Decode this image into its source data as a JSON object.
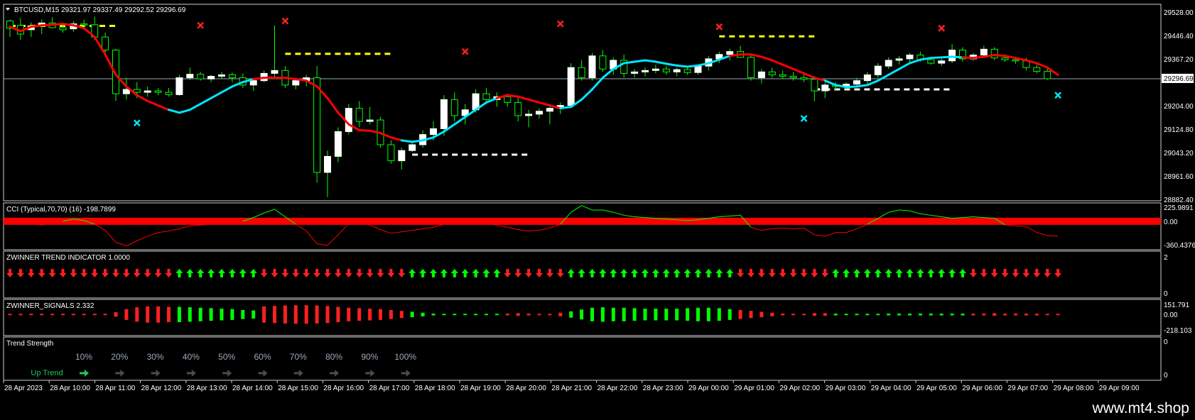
{
  "main": {
    "header": "BTCUSD,M15  29321.97 29337.49 29292.52 29296.69",
    "ylim": [
      28882.4,
      29528.0
    ],
    "y_ticks": [
      "29528.00",
      "29446.40",
      "29367.20",
      "29204.00",
      "29124.80",
      "29043.20",
      "28961.60",
      "28882.40"
    ],
    "current_price": "29296.69",
    "candle_colors": {
      "bull": "#ffffff",
      "bear": "#000000",
      "wick": "#00ff00",
      "outline": "#00ff00"
    },
    "trend_colors": {
      "down": "#ff0000",
      "up": "#00e5ff"
    }
  },
  "cci": {
    "label": "CCI (Typical,70,70) (16) -198.7899",
    "ticks": [
      "225.9891",
      "0.00",
      "-360.4376"
    ],
    "line_color": "#ff0000",
    "up_color": "#00ff00"
  },
  "trend_panel": {
    "label": "ZWINNER TREND INDICATOR 1.0000",
    "ticks": [
      "2",
      "0"
    ],
    "up_color": "#00ff00",
    "down_color": "#ff2020"
  },
  "signals": {
    "label": "ZWINNER_SIGNALS 2.332",
    "ticks": [
      "151.791",
      "0.00",
      "-218.103"
    ]
  },
  "strength": {
    "label": "Trend Strength",
    "ticks": [
      "0",
      "0"
    ],
    "percents": [
      "10%",
      "20%",
      "30%",
      "40%",
      "50%",
      "60%",
      "70%",
      "80%",
      "90%",
      "100%"
    ],
    "trend_label": "Up Trend"
  },
  "time_axis": [
    "28 Apr 2023",
    "28 Apr 10:00",
    "28 Apr 11:00",
    "28 Apr 12:00",
    "28 Apr 13:00",
    "28 Apr 14:00",
    "28 Apr 15:00",
    "28 Apr 16:00",
    "28 Apr 17:00",
    "28 Apr 18:00",
    "28 Apr 19:00",
    "28 Apr 20:00",
    "28 Apr 21:00",
    "28 Apr 22:00",
    "28 Apr 23:00",
    "29 Apr 00:00",
    "29 Apr 01:00",
    "29 Apr 02:00",
    "29 Apr 03:00",
    "29 Apr 04:00",
    "29 Apr 05:00",
    "29 Apr 06:00",
    "29 Apr 07:00",
    "29 Apr 08:00",
    "29 Apr 09:00"
  ],
  "footer": {
    "url": "www.mt4.shop"
  },
  "chart_data": {
    "type": "candlestick",
    "symbol": "BTCUSD",
    "timeframe": "M15",
    "ylim": [
      28882.4,
      29528.0
    ],
    "candles": [
      {
        "o": 29495,
        "h": 29500,
        "l": 29440,
        "c": 29470
      },
      {
        "o": 29480,
        "h": 29505,
        "l": 29430,
        "c": 29450
      },
      {
        "o": 29465,
        "h": 29490,
        "l": 29440,
        "c": 29478
      },
      {
        "o": 29478,
        "h": 29500,
        "l": 29450,
        "c": 29488
      },
      {
        "o": 29488,
        "h": 29508,
        "l": 29470,
        "c": 29472
      },
      {
        "o": 29472,
        "h": 29485,
        "l": 29455,
        "c": 29465
      },
      {
        "o": 29468,
        "h": 29495,
        "l": 29458,
        "c": 29485
      },
      {
        "o": 29485,
        "h": 29500,
        "l": 29470,
        "c": 29482
      },
      {
        "o": 29482,
        "h": 29510,
        "l": 29430,
        "c": 29440
      },
      {
        "o": 29440,
        "h": 29455,
        "l": 29380,
        "c": 29395
      },
      {
        "o": 29395,
        "h": 29400,
        "l": 29220,
        "c": 29245
      },
      {
        "o": 29245,
        "h": 29300,
        "l": 29225,
        "c": 29260
      },
      {
        "o": 29260,
        "h": 29285,
        "l": 29230,
        "c": 29250
      },
      {
        "o": 29250,
        "h": 29270,
        "l": 29235,
        "c": 29255
      },
      {
        "o": 29255,
        "h": 29265,
        "l": 29240,
        "c": 29250
      },
      {
        "o": 29250,
        "h": 29265,
        "l": 29235,
        "c": 29242
      },
      {
        "o": 29242,
        "h": 29310,
        "l": 29238,
        "c": 29300
      },
      {
        "o": 29300,
        "h": 29335,
        "l": 29292,
        "c": 29312
      },
      {
        "o": 29312,
        "h": 29320,
        "l": 29290,
        "c": 29296
      },
      {
        "o": 29296,
        "h": 29310,
        "l": 29285,
        "c": 29305
      },
      {
        "o": 29305,
        "h": 29320,
        "l": 29295,
        "c": 29310
      },
      {
        "o": 29310,
        "h": 29318,
        "l": 29285,
        "c": 29300
      },
      {
        "o": 29300,
        "h": 29315,
        "l": 29265,
        "c": 29275
      },
      {
        "o": 29275,
        "h": 29300,
        "l": 29255,
        "c": 29290
      },
      {
        "o": 29290,
        "h": 29325,
        "l": 29285,
        "c": 29315
      },
      {
        "o": 29315,
        "h": 29480,
        "l": 29300,
        "c": 29325
      },
      {
        "o": 29325,
        "h": 29340,
        "l": 29265,
        "c": 29275
      },
      {
        "o": 29275,
        "h": 29300,
        "l": 29260,
        "c": 29290
      },
      {
        "o": 29290,
        "h": 29310,
        "l": 29270,
        "c": 29300
      },
      {
        "o": 29300,
        "h": 29340,
        "l": 28940,
        "c": 28975
      },
      {
        "o": 28975,
        "h": 29050,
        "l": 28890,
        "c": 29030
      },
      {
        "o": 29030,
        "h": 29130,
        "l": 29010,
        "c": 29115
      },
      {
        "o": 29115,
        "h": 29210,
        "l": 29105,
        "c": 29195
      },
      {
        "o": 29195,
        "h": 29220,
        "l": 29130,
        "c": 29150
      },
      {
        "o": 29150,
        "h": 29200,
        "l": 29140,
        "c": 29155
      },
      {
        "o": 29155,
        "h": 29165,
        "l": 29060,
        "c": 29070
      },
      {
        "o": 29070,
        "h": 29085,
        "l": 29005,
        "c": 29015
      },
      {
        "o": 29015,
        "h": 29060,
        "l": 28985,
        "c": 29050
      },
      {
        "o": 29050,
        "h": 29080,
        "l": 29045,
        "c": 29070
      },
      {
        "o": 29070,
        "h": 29120,
        "l": 29060,
        "c": 29105
      },
      {
        "o": 29105,
        "h": 29150,
        "l": 29085,
        "c": 29125
      },
      {
        "o": 29125,
        "h": 29240,
        "l": 29100,
        "c": 29225
      },
      {
        "o": 29225,
        "h": 29250,
        "l": 29150,
        "c": 29170
      },
      {
        "o": 29170,
        "h": 29210,
        "l": 29140,
        "c": 29190
      },
      {
        "o": 29190,
        "h": 29260,
        "l": 29180,
        "c": 29245
      },
      {
        "o": 29245,
        "h": 29265,
        "l": 29210,
        "c": 29225
      },
      {
        "o": 29225,
        "h": 29250,
        "l": 29200,
        "c": 29235
      },
      {
        "o": 29235,
        "h": 29245,
        "l": 29200,
        "c": 29215
      },
      {
        "o": 29215,
        "h": 29240,
        "l": 29150,
        "c": 29170
      },
      {
        "o": 29170,
        "h": 29190,
        "l": 29130,
        "c": 29175
      },
      {
        "o": 29175,
        "h": 29195,
        "l": 29160,
        "c": 29185
      },
      {
        "o": 29185,
        "h": 29210,
        "l": 29140,
        "c": 29195
      },
      {
        "o": 29195,
        "h": 29215,
        "l": 29175,
        "c": 29205
      },
      {
        "o": 29205,
        "h": 29350,
        "l": 29200,
        "c": 29335
      },
      {
        "o": 29335,
        "h": 29360,
        "l": 29290,
        "c": 29300
      },
      {
        "o": 29300,
        "h": 29385,
        "l": 29290,
        "c": 29375
      },
      {
        "o": 29375,
        "h": 29395,
        "l": 29320,
        "c": 29330
      },
      {
        "o": 29330,
        "h": 29370,
        "l": 29310,
        "c": 29360
      },
      {
        "o": 29360,
        "h": 29380,
        "l": 29300,
        "c": 29315
      },
      {
        "o": 29315,
        "h": 29330,
        "l": 29300,
        "c": 29320
      },
      {
        "o": 29320,
        "h": 29335,
        "l": 29305,
        "c": 29325
      },
      {
        "o": 29325,
        "h": 29345,
        "l": 29315,
        "c": 29330
      },
      {
        "o": 29330,
        "h": 29340,
        "l": 29310,
        "c": 29320
      },
      {
        "o": 29320,
        "h": 29335,
        "l": 29305,
        "c": 29328
      },
      {
        "o": 29328,
        "h": 29340,
        "l": 29310,
        "c": 29318
      },
      {
        "o": 29318,
        "h": 29345,
        "l": 29310,
        "c": 29340
      },
      {
        "o": 29340,
        "h": 29375,
        "l": 29325,
        "c": 29365
      },
      {
        "o": 29365,
        "h": 29390,
        "l": 29350,
        "c": 29380
      },
      {
        "o": 29380,
        "h": 29400,
        "l": 29360,
        "c": 29390
      },
      {
        "o": 29390,
        "h": 29410,
        "l": 29370,
        "c": 29370
      },
      {
        "o": 29370,
        "h": 29380,
        "l": 29290,
        "c": 29300
      },
      {
        "o": 29300,
        "h": 29330,
        "l": 29280,
        "c": 29320
      },
      {
        "o": 29320,
        "h": 29335,
        "l": 29300,
        "c": 29310
      },
      {
        "o": 29310,
        "h": 29325,
        "l": 29295,
        "c": 29305
      },
      {
        "o": 29305,
        "h": 29320,
        "l": 29290,
        "c": 29300
      },
      {
        "o": 29300,
        "h": 29315,
        "l": 29285,
        "c": 29295
      },
      {
        "o": 29295,
        "h": 29305,
        "l": 29220,
        "c": 29255
      },
      {
        "o": 29255,
        "h": 29285,
        "l": 29230,
        "c": 29275
      },
      {
        "o": 29275,
        "h": 29285,
        "l": 29255,
        "c": 29270
      },
      {
        "o": 29270,
        "h": 29285,
        "l": 29260,
        "c": 29278
      },
      {
        "o": 29278,
        "h": 29300,
        "l": 29268,
        "c": 29290
      },
      {
        "o": 29290,
        "h": 29320,
        "l": 29280,
        "c": 29310
      },
      {
        "o": 29310,
        "h": 29350,
        "l": 29300,
        "c": 29340
      },
      {
        "o": 29340,
        "h": 29370,
        "l": 29330,
        "c": 29360
      },
      {
        "o": 29360,
        "h": 29375,
        "l": 29345,
        "c": 29365
      },
      {
        "o": 29365,
        "h": 29385,
        "l": 29350,
        "c": 29378
      },
      {
        "o": 29378,
        "h": 29390,
        "l": 29355,
        "c": 29362
      },
      {
        "o": 29362,
        "h": 29370,
        "l": 29345,
        "c": 29350
      },
      {
        "o": 29350,
        "h": 29365,
        "l": 29340,
        "c": 29358
      },
      {
        "o": 29358,
        "h": 29415,
        "l": 29350,
        "c": 29395
      },
      {
        "o": 29395,
        "h": 29405,
        "l": 29355,
        "c": 29365
      },
      {
        "o": 29365,
        "h": 29385,
        "l": 29358,
        "c": 29378
      },
      {
        "o": 29378,
        "h": 29410,
        "l": 29370,
        "c": 29398
      },
      {
        "o": 29398,
        "h": 29405,
        "l": 29360,
        "c": 29368
      },
      {
        "o": 29368,
        "h": 29380,
        "l": 29355,
        "c": 29362
      },
      {
        "o": 29362,
        "h": 29372,
        "l": 29348,
        "c": 29358
      },
      {
        "o": 29358,
        "h": 29368,
        "l": 29325,
        "c": 29335
      },
      {
        "o": 29335,
        "h": 29345,
        "l": 29315,
        "c": 29322
      },
      {
        "o": 29321.97,
        "h": 29337.49,
        "l": 29292.52,
        "c": 29296.69
      }
    ],
    "trend_line": [
      29475,
      29460,
      29475,
      29480,
      29482,
      29485,
      29480,
      29470,
      29440,
      29380,
      29310,
      29270,
      29240,
      29220,
      29205,
      29190,
      29180,
      29190,
      29210,
      29230,
      29250,
      29270,
      29285,
      29295,
      29300,
      29300,
      29300,
      29295,
      29290,
      29270,
      29230,
      29180,
      29140,
      29120,
      29118,
      29110,
      29095,
      29085,
      29080,
      29085,
      29095,
      29115,
      29140,
      29165,
      29190,
      29215,
      29230,
      29240,
      29235,
      29225,
      29215,
      29205,
      29195,
      29200,
      29225,
      29260,
      29300,
      29330,
      29350,
      29355,
      29360,
      29355,
      29348,
      29342,
      29338,
      29342,
      29350,
      29362,
      29375,
      29380,
      29380,
      29372,
      29360,
      29345,
      29330,
      29315,
      29300,
      29290,
      29275,
      29268,
      29270,
      29275,
      29290,
      29310,
      29330,
      29350,
      29362,
      29368,
      29370,
      29372,
      29370,
      29368,
      29372,
      29378,
      29375,
      29368,
      29360,
      29350,
      29335,
      29310
    ],
    "trend_up": [
      0,
      0,
      0,
      0,
      0,
      0,
      0,
      0,
      0,
      0,
      0,
      0,
      0,
      0,
      0,
      0,
      1,
      1,
      1,
      1,
      1,
      1,
      1,
      1,
      0,
      0,
      0,
      0,
      0,
      0,
      0,
      0,
      0,
      0,
      0,
      0,
      0,
      0,
      1,
      1,
      1,
      1,
      1,
      1,
      1,
      1,
      1,
      0,
      0,
      0,
      0,
      0,
      0,
      1,
      1,
      1,
      1,
      1,
      1,
      1,
      1,
      1,
      1,
      1,
      1,
      1,
      1,
      1,
      1,
      0,
      0,
      0,
      0,
      0,
      0,
      0,
      0,
      0,
      1,
      1,
      1,
      1,
      1,
      1,
      1,
      1,
      1,
      1,
      1,
      1,
      1,
      0,
      0,
      0,
      0,
      0,
      0,
      0,
      0,
      0
    ],
    "sell_marks": [
      {
        "i": 18,
        "p": 29480
      },
      {
        "i": 26,
        "p": 29495
      },
      {
        "i": 43,
        "p": 29390
      },
      {
        "i": 52,
        "p": 29485
      },
      {
        "i": 67,
        "p": 29475
      },
      {
        "i": 88,
        "p": 29470
      }
    ],
    "buy_marks": [
      {
        "i": 12,
        "p": 29145
      },
      {
        "i": 75,
        "p": 29160
      },
      {
        "i": 99,
        "p": 29240
      }
    ],
    "levels": [
      {
        "price": 29478,
        "from": 0,
        "to": 10,
        "color": "#ffff00"
      },
      {
        "price": 29382,
        "from": 26,
        "to": 36,
        "color": "#ffff00"
      },
      {
        "price": 29036,
        "from": 38,
        "to": 49,
        "color": "#ffffff"
      },
      {
        "price": 29442,
        "from": 67,
        "to": 76,
        "color": "#ffff00"
      },
      {
        "price": 29260,
        "from": 76,
        "to": 89,
        "color": "#ffffff"
      }
    ],
    "cci_values": [
      0,
      -10,
      -30,
      -50,
      -20,
      0,
      30,
      10,
      -40,
      -120,
      -280,
      -330,
      -260,
      -200,
      -150,
      -130,
      -100,
      -60,
      -50,
      -40,
      -30,
      -20,
      0,
      50,
      110,
      160,
      60,
      -40,
      -130,
      -300,
      -320,
      -180,
      -30,
      -10,
      -50,
      -110,
      -160,
      -140,
      -120,
      -100,
      -80,
      -40,
      -20,
      -30,
      -40,
      -30,
      -50,
      -80,
      -110,
      -130,
      -120,
      -90,
      -40,
      120,
      210,
      150,
      150,
      120,
      80,
      60,
      50,
      40,
      30,
      20,
      10,
      20,
      40,
      60,
      70,
      80,
      -80,
      -120,
      -100,
      -90,
      -100,
      -90,
      -180,
      -200,
      -150,
      -150,
      -100,
      -40,
      40,
      120,
      150,
      140,
      100,
      80,
      60,
      40,
      50,
      60,
      50,
      40,
      -50,
      -60,
      -70,
      -150,
      -190,
      -198.79
    ],
    "signal_values": [
      0,
      0,
      0,
      0,
      0,
      0,
      0,
      0,
      0,
      -5,
      -50,
      -120,
      -160,
      -180,
      -180,
      -170,
      170,
      160,
      150,
      140,
      130,
      120,
      100,
      90,
      -180,
      -190,
      -200,
      -205,
      -205,
      -200,
      -190,
      -170,
      -150,
      -140,
      -130,
      -120,
      -100,
      -80,
      60,
      40,
      20,
      10,
      5,
      0,
      -5,
      -10,
      -15,
      -20,
      -30,
      -20,
      -10,
      0,
      40,
      70,
      110,
      150,
      160,
      150,
      150,
      140,
      130,
      130,
      130,
      130,
      140,
      150,
      -150,
      -140,
      -120,
      -100,
      -80,
      -60,
      -40,
      -20,
      -5,
      -15,
      -30,
      -30,
      -20,
      -10,
      5,
      10,
      15,
      20,
      20,
      20,
      20,
      20,
      20,
      20,
      20,
      20,
      -20,
      -30,
      -20,
      -20,
      -20,
      -20,
      -15,
      -10
    ]
  }
}
